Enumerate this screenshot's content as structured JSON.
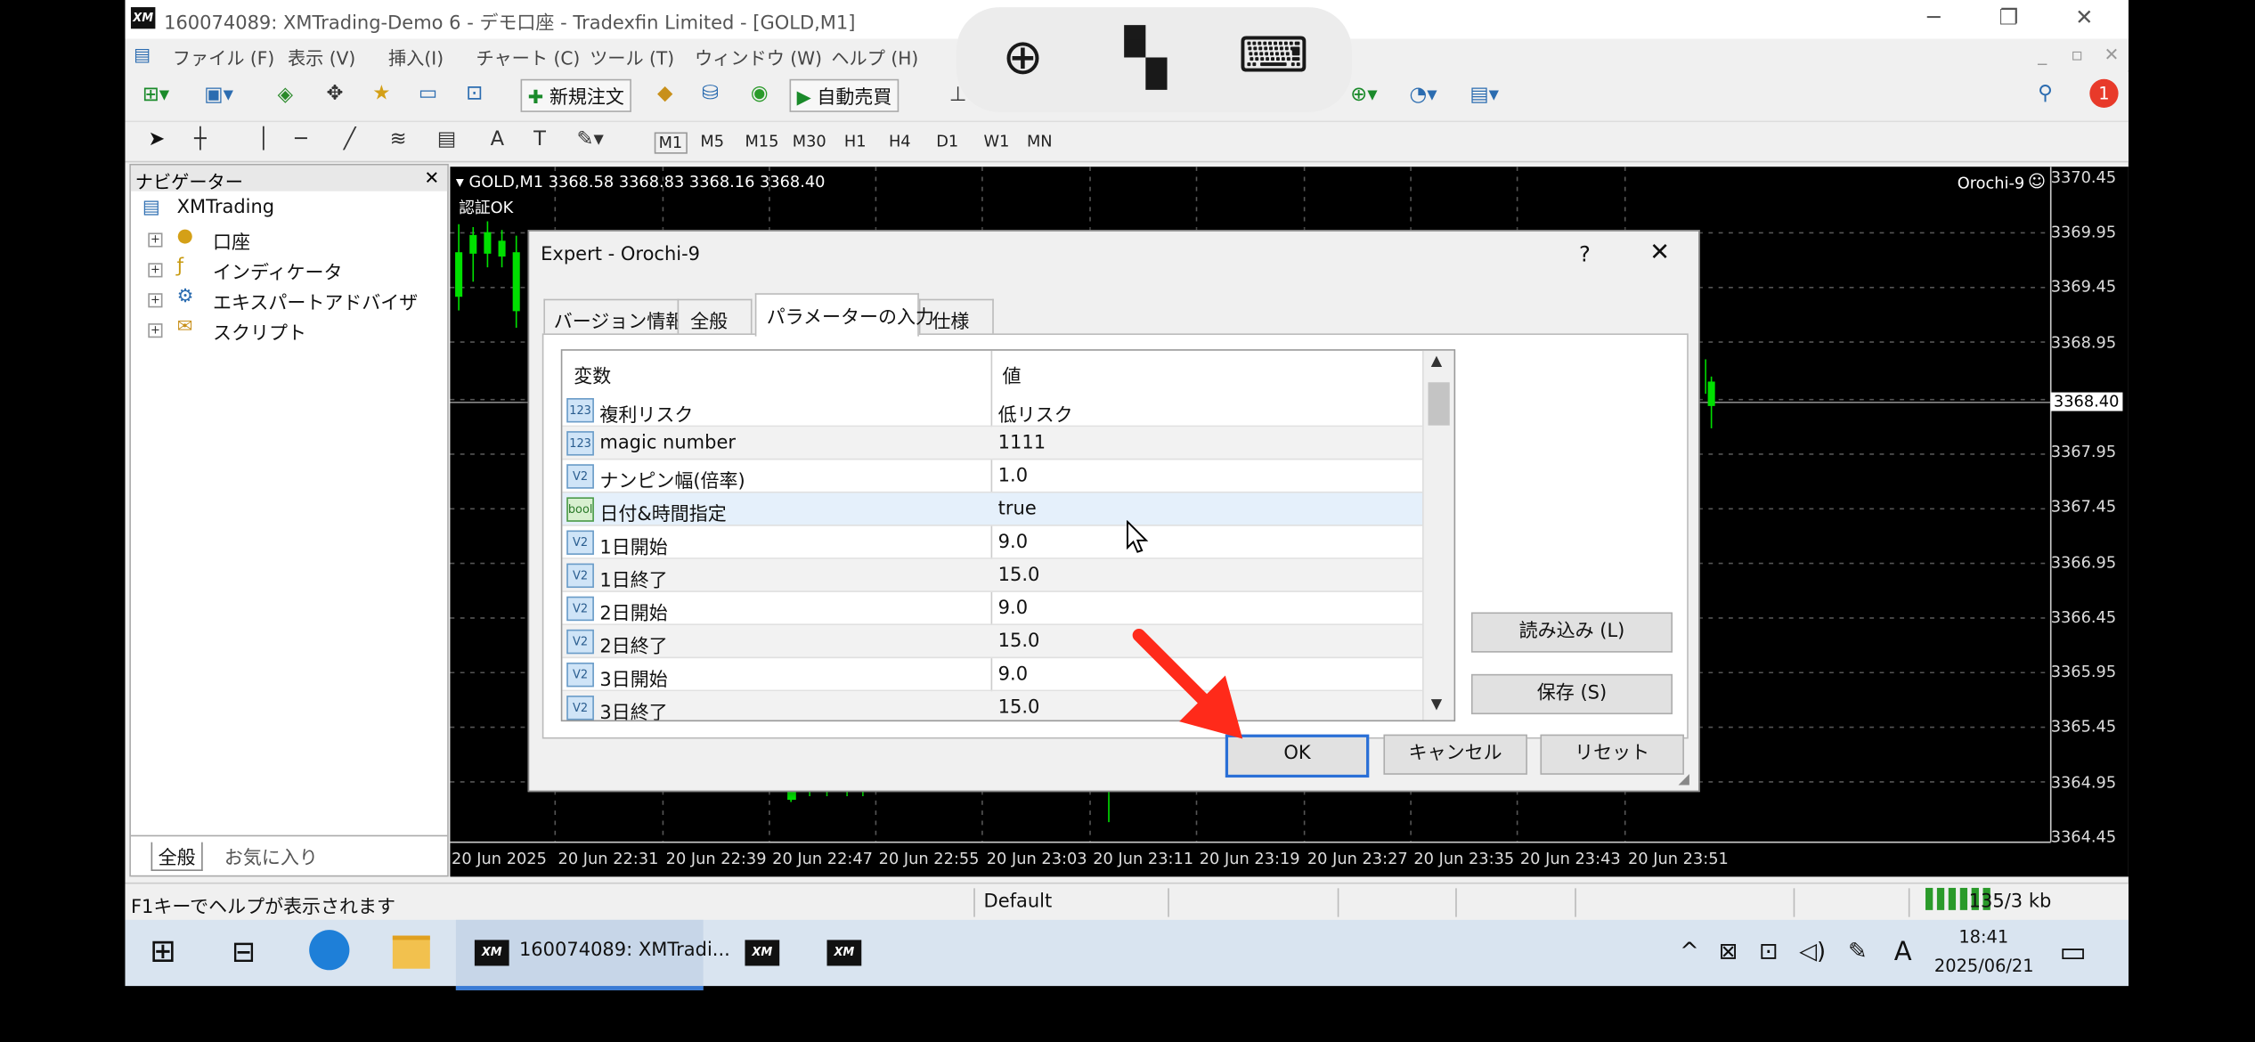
{
  "window": {
    "title": "160074089: XMTrading-Demo 6 - デモ口座 - Tradexfin Limited - [GOLD,M1]",
    "logo": "XM"
  },
  "menu": [
    "ファイル (F)",
    "表示 (V)",
    "挿入(I)",
    "チャート (C)",
    "ツール (T)",
    "ウィンドウ (W)",
    "ヘルプ (H)"
  ],
  "toolbar": {
    "new_order": "新規注文",
    "auto_trade": "自動売買",
    "notification_badge": "1"
  },
  "timeframes": [
    "M1",
    "M5",
    "M15",
    "M30",
    "H1",
    "H4",
    "D1",
    "W1",
    "MN"
  ],
  "navigator": {
    "title": "ナビゲーター",
    "root": "XMTrading",
    "items": [
      "口座",
      "インディケータ",
      "エキスパートアドバイザ",
      "スクリプト"
    ],
    "tabs": [
      "全般",
      "お気に入り"
    ]
  },
  "chart": {
    "header": "GOLD,M1  3368.58 3368.83 3368.16 3368.40",
    "auth": "認証OK",
    "ea_label": "Orochi-9",
    "price_labels": [
      "3370.45",
      "3369.95",
      "3369.45",
      "3368.95",
      "3368.40",
      "3367.95",
      "3367.45",
      "3366.95",
      "3366.45",
      "3365.95",
      "3365.45",
      "3364.95",
      "3364.45"
    ],
    "time_labels": [
      "20 Jun 2025",
      "20 Jun 22:31",
      "20 Jun 22:39",
      "20 Jun 22:47",
      "20 Jun 22:55",
      "20 Jun 23:03",
      "20 Jun 23:11",
      "20 Jun 23:19",
      "20 Jun 23:27",
      "20 Jun 23:35",
      "20 Jun 23:43",
      "20 Jun 23:51"
    ]
  },
  "dialog": {
    "title": "Expert - Orochi-9",
    "help": "?",
    "tabs": [
      "バージョン情報",
      "全般",
      "パラメーターの入力",
      "仕様"
    ],
    "active_tab": "パラメーターの入力",
    "columns": [
      "変数",
      "値"
    ],
    "params": [
      {
        "icon": "123",
        "name": "複利リスク",
        "value": "低リスク"
      },
      {
        "icon": "123",
        "name": "magic number",
        "value": "1111"
      },
      {
        "icon": "V2",
        "name": "ナンピン幅(倍率)",
        "value": "1.0"
      },
      {
        "icon": "bool",
        "name": "日付&時間指定",
        "value": "true"
      },
      {
        "icon": "V2",
        "name": "1日開始",
        "value": "9.0"
      },
      {
        "icon": "V2",
        "name": "1日終了",
        "value": "15.0"
      },
      {
        "icon": "V2",
        "name": "2日開始",
        "value": "9.0"
      },
      {
        "icon": "V2",
        "name": "2日終了",
        "value": "15.0"
      },
      {
        "icon": "V2",
        "name": "3日開始",
        "value": "9.0"
      },
      {
        "icon": "V2",
        "name": "3日終了",
        "value": "15.0"
      }
    ],
    "load_button": "読み込み (L)",
    "save_button": "保存 (S)",
    "ok_button": "OK",
    "cancel_button": "キャンセル",
    "reset_button": "リセット"
  },
  "statusbar": {
    "help": "F1キーでヘルプが表示されます",
    "profile": "Default",
    "traffic": "135/3 kb"
  },
  "taskbar": {
    "active_app": "160074089: XMTradi...",
    "time": "18:41",
    "date": "2025/06/21",
    "ime": "A"
  },
  "colors": {
    "arrow": "#ff2a1a",
    "candle_up": "#00e000",
    "dialog_default_border": "#2a6fd6"
  }
}
